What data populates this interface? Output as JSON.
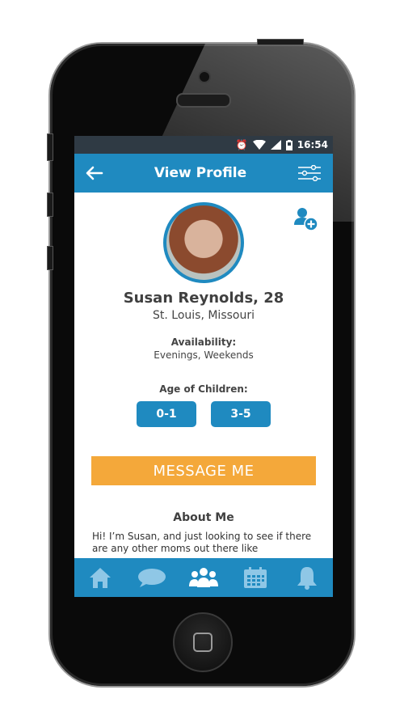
{
  "status_bar": {
    "time": "16:54",
    "icons": [
      "alarm-icon",
      "wifi-icon",
      "signal-icon",
      "battery-icon"
    ]
  },
  "header": {
    "title": "View Profile",
    "back_icon": "back-arrow-icon",
    "filter_icon": "filter-sliders-icon"
  },
  "profile": {
    "name": "Susan Reynolds, 28",
    "location": "St. Louis, Missouri",
    "availability_label": "Availability:",
    "availability_value": "Evenings, Weekends",
    "children_label": "Age of Children:",
    "children_ages": [
      "0-1",
      "3-5"
    ],
    "message_button": "MESSAGE ME",
    "about_title": "About Me",
    "about_text": "Hi! I’m Susan, and just looking to see if there are any other moms out there like"
  },
  "tabs": [
    "home-icon",
    "chat-icon",
    "group-icon",
    "calendar-icon",
    "bell-icon"
  ],
  "colors": {
    "primary": "#1f8ac0",
    "accent": "#f4a83a",
    "statusbar": "#2f3a44"
  }
}
